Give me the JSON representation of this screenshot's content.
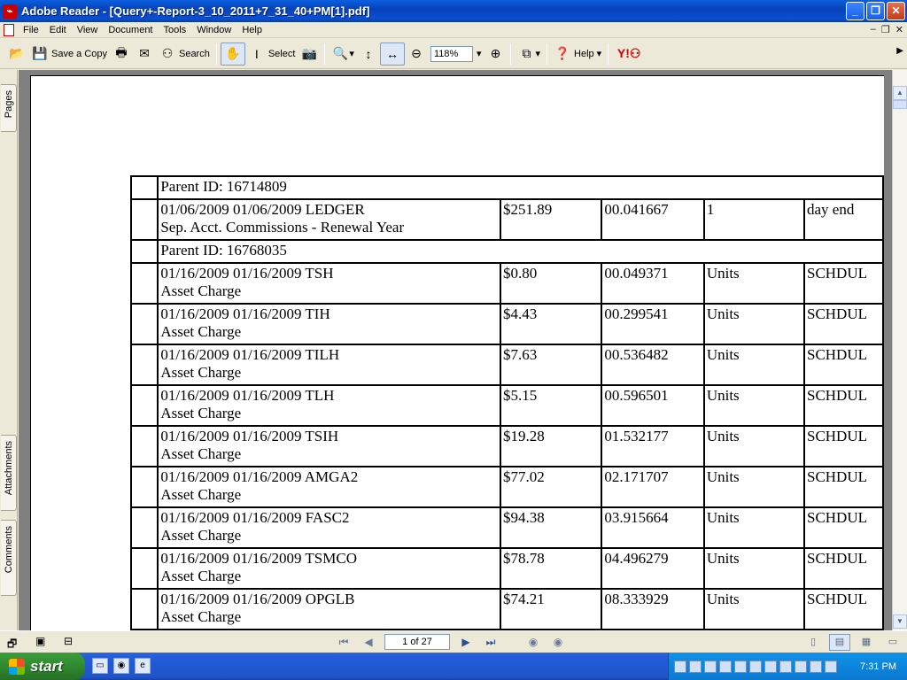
{
  "window": {
    "title": "Adobe Reader - [Query+-Report-3_10_2011+7_31_40+PM[1].pdf]"
  },
  "menu": [
    "File",
    "Edit",
    "View",
    "Document",
    "Tools",
    "Window",
    "Help"
  ],
  "toolbar": {
    "save_copy": "Save a Copy",
    "search": "Search",
    "select": "Select",
    "zoom": "118%",
    "help": "Help"
  },
  "navtabs": [
    "Pages",
    "Attachments",
    "Comments"
  ],
  "report": {
    "groups": [
      {
        "parent": "Parent ID: 16714809",
        "rows": [
          {
            "line1": "01/06/2009 01/06/2009 LEDGER",
            "line2": "Sep. Acct. Commissions - Renewal Year",
            "amount": "$251.89",
            "rate": "00.041667",
            "basis": "1",
            "type": "day end"
          }
        ]
      },
      {
        "parent": "Parent ID: 16768035",
        "rows": [
          {
            "line1": "01/16/2009 01/16/2009 TSH",
            "line2": "Asset Charge",
            "amount": "$0.80",
            "rate": "00.049371",
            "basis": "Units",
            "type": "SCHDUL"
          },
          {
            "line1": "01/16/2009 01/16/2009 TIH",
            "line2": "Asset Charge",
            "amount": "$4.43",
            "rate": "00.299541",
            "basis": "Units",
            "type": "SCHDUL"
          },
          {
            "line1": "01/16/2009 01/16/2009 TILH",
            "line2": "Asset Charge",
            "amount": "$7.63",
            "rate": "00.536482",
            "basis": "Units",
            "type": "SCHDUL"
          },
          {
            "line1": "01/16/2009 01/16/2009 TLH",
            "line2": "Asset Charge",
            "amount": "$5.15",
            "rate": "00.596501",
            "basis": "Units",
            "type": "SCHDUL"
          },
          {
            "line1": "01/16/2009 01/16/2009 TSIH",
            "line2": "Asset Charge",
            "amount": "$19.28",
            "rate": "01.532177",
            "basis": "Units",
            "type": "SCHDUL"
          },
          {
            "line1": "01/16/2009 01/16/2009 AMGA2",
            "line2": "Asset Charge",
            "amount": "$77.02",
            "rate": "02.171707",
            "basis": "Units",
            "type": "SCHDUL"
          },
          {
            "line1": "01/16/2009 01/16/2009 FASC2",
            "line2": "Asset Charge",
            "amount": "$94.38",
            "rate": "03.915664",
            "basis": "Units",
            "type": "SCHDUL"
          },
          {
            "line1": "01/16/2009 01/16/2009 TSMCO",
            "line2": "Asset Charge",
            "amount": "$78.78",
            "rate": "04.496279",
            "basis": "Units",
            "type": "SCHDUL"
          },
          {
            "line1": "01/16/2009 01/16/2009 OPGLB",
            "line2": "Asset Charge",
            "amount": "$74.21",
            "rate": "08.333929",
            "basis": "Units",
            "type": "SCHDUL"
          }
        ]
      }
    ]
  },
  "status": {
    "page_field": "1 of 27"
  },
  "taskbar": {
    "start": "start",
    "clock": "7:31 PM"
  }
}
